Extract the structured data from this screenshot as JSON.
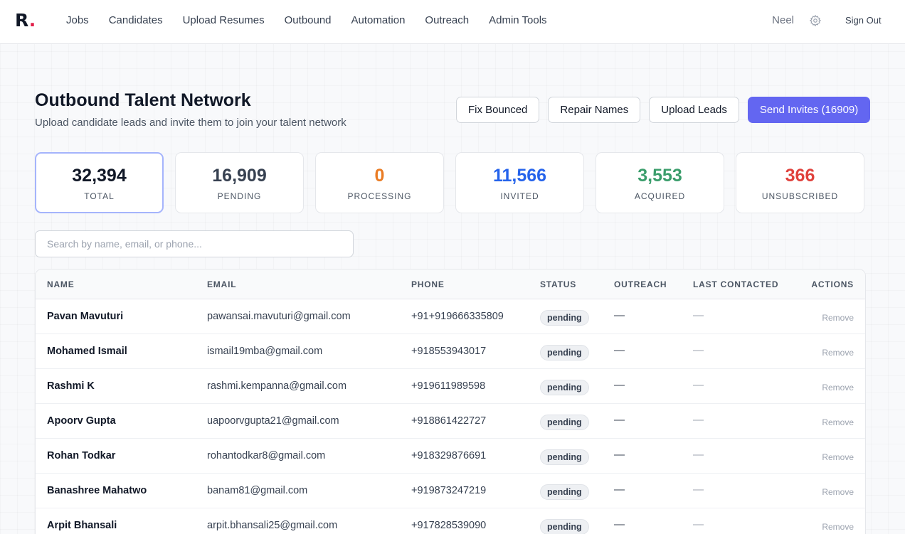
{
  "nav": {
    "logo": "R",
    "links": [
      "Jobs",
      "Candidates",
      "Upload Resumes",
      "Outbound",
      "Automation",
      "Outreach",
      "Admin Tools"
    ],
    "user": "Neel",
    "sign_out": "Sign Out"
  },
  "header": {
    "title": "Outbound Talent Network",
    "subtitle": "Upload candidate leads and invite them to join your talent network",
    "buttons": {
      "fix_bounced": "Fix Bounced",
      "repair_names": "Repair Names",
      "upload_leads": "Upload Leads",
      "send_invites": "Send Invites (16909)"
    }
  },
  "stats": [
    {
      "value": "32,394",
      "label": "TOTAL",
      "color": "#111827"
    },
    {
      "value": "16,909",
      "label": "PENDING",
      "color": "#374151"
    },
    {
      "value": "0",
      "label": "PROCESSING",
      "color": "#ea7c24"
    },
    {
      "value": "11,566",
      "label": "INVITED",
      "color": "#2563eb"
    },
    {
      "value": "3,553",
      "label": "ACQUIRED",
      "color": "#3a9d6b"
    },
    {
      "value": "366",
      "label": "UNSUBSCRIBED",
      "color": "#e0413c"
    }
  ],
  "search": {
    "placeholder": "Search by name, email, or phone..."
  },
  "table": {
    "columns": [
      "NAME",
      "EMAIL",
      "PHONE",
      "STATUS",
      "OUTREACH",
      "LAST CONTACTED",
      "ACTIONS"
    ],
    "rows": [
      {
        "name": "Pavan Mavuturi",
        "email": "pawansai.mavuturi@gmail.com",
        "phone": "+91+919666335809",
        "status": "pending",
        "outreach": "—",
        "last_contacted": "—",
        "action": "Remove"
      },
      {
        "name": "Mohamed Ismail",
        "email": "ismail19mba@gmail.com",
        "phone": "+918553943017",
        "status": "pending",
        "outreach": "—",
        "last_contacted": "—",
        "action": "Remove"
      },
      {
        "name": "Rashmi K",
        "email": "rashmi.kempanna@gmail.com",
        "phone": "+919611989598",
        "status": "pending",
        "outreach": "—",
        "last_contacted": "—",
        "action": "Remove"
      },
      {
        "name": "Apoorv Gupta",
        "email": "uapoorvgupta21@gmail.com",
        "phone": "+918861422727",
        "status": "pending",
        "outreach": "—",
        "last_contacted": "—",
        "action": "Remove"
      },
      {
        "name": "Rohan Todkar",
        "email": "rohantodkar8@gmail.com",
        "phone": "+918329876691",
        "status": "pending",
        "outreach": "—",
        "last_contacted": "—",
        "action": "Remove"
      },
      {
        "name": "Banashree Mahatwo",
        "email": "banam81@gmail.com",
        "phone": "+919873247219",
        "status": "pending",
        "outreach": "—",
        "last_contacted": "—",
        "action": "Remove"
      },
      {
        "name": "Arpit Bhansali",
        "email": "arpit.bhansali25@gmail.com",
        "phone": "+917828539090",
        "status": "pending",
        "outreach": "—",
        "last_contacted": "—",
        "action": "Remove"
      }
    ]
  }
}
